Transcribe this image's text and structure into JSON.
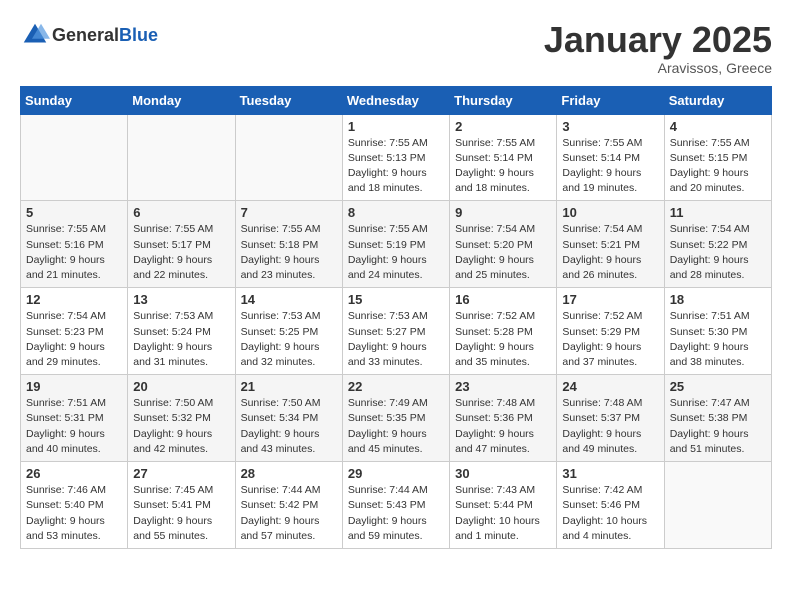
{
  "header": {
    "logo_general": "General",
    "logo_blue": "Blue",
    "month": "January 2025",
    "location": "Aravissos, Greece"
  },
  "weekdays": [
    "Sunday",
    "Monday",
    "Tuesday",
    "Wednesday",
    "Thursday",
    "Friday",
    "Saturday"
  ],
  "weeks": [
    [
      {
        "day": "",
        "info": ""
      },
      {
        "day": "",
        "info": ""
      },
      {
        "day": "",
        "info": ""
      },
      {
        "day": "1",
        "info": "Sunrise: 7:55 AM\nSunset: 5:13 PM\nDaylight: 9 hours and 18 minutes."
      },
      {
        "day": "2",
        "info": "Sunrise: 7:55 AM\nSunset: 5:14 PM\nDaylight: 9 hours and 18 minutes."
      },
      {
        "day": "3",
        "info": "Sunrise: 7:55 AM\nSunset: 5:14 PM\nDaylight: 9 hours and 19 minutes."
      },
      {
        "day": "4",
        "info": "Sunrise: 7:55 AM\nSunset: 5:15 PM\nDaylight: 9 hours and 20 minutes."
      }
    ],
    [
      {
        "day": "5",
        "info": "Sunrise: 7:55 AM\nSunset: 5:16 PM\nDaylight: 9 hours and 21 minutes."
      },
      {
        "day": "6",
        "info": "Sunrise: 7:55 AM\nSunset: 5:17 PM\nDaylight: 9 hours and 22 minutes."
      },
      {
        "day": "7",
        "info": "Sunrise: 7:55 AM\nSunset: 5:18 PM\nDaylight: 9 hours and 23 minutes."
      },
      {
        "day": "8",
        "info": "Sunrise: 7:55 AM\nSunset: 5:19 PM\nDaylight: 9 hours and 24 minutes."
      },
      {
        "day": "9",
        "info": "Sunrise: 7:54 AM\nSunset: 5:20 PM\nDaylight: 9 hours and 25 minutes."
      },
      {
        "day": "10",
        "info": "Sunrise: 7:54 AM\nSunset: 5:21 PM\nDaylight: 9 hours and 26 minutes."
      },
      {
        "day": "11",
        "info": "Sunrise: 7:54 AM\nSunset: 5:22 PM\nDaylight: 9 hours and 28 minutes."
      }
    ],
    [
      {
        "day": "12",
        "info": "Sunrise: 7:54 AM\nSunset: 5:23 PM\nDaylight: 9 hours and 29 minutes."
      },
      {
        "day": "13",
        "info": "Sunrise: 7:53 AM\nSunset: 5:24 PM\nDaylight: 9 hours and 31 minutes."
      },
      {
        "day": "14",
        "info": "Sunrise: 7:53 AM\nSunset: 5:25 PM\nDaylight: 9 hours and 32 minutes."
      },
      {
        "day": "15",
        "info": "Sunrise: 7:53 AM\nSunset: 5:27 PM\nDaylight: 9 hours and 33 minutes."
      },
      {
        "day": "16",
        "info": "Sunrise: 7:52 AM\nSunset: 5:28 PM\nDaylight: 9 hours and 35 minutes."
      },
      {
        "day": "17",
        "info": "Sunrise: 7:52 AM\nSunset: 5:29 PM\nDaylight: 9 hours and 37 minutes."
      },
      {
        "day": "18",
        "info": "Sunrise: 7:51 AM\nSunset: 5:30 PM\nDaylight: 9 hours and 38 minutes."
      }
    ],
    [
      {
        "day": "19",
        "info": "Sunrise: 7:51 AM\nSunset: 5:31 PM\nDaylight: 9 hours and 40 minutes."
      },
      {
        "day": "20",
        "info": "Sunrise: 7:50 AM\nSunset: 5:32 PM\nDaylight: 9 hours and 42 minutes."
      },
      {
        "day": "21",
        "info": "Sunrise: 7:50 AM\nSunset: 5:34 PM\nDaylight: 9 hours and 43 minutes."
      },
      {
        "day": "22",
        "info": "Sunrise: 7:49 AM\nSunset: 5:35 PM\nDaylight: 9 hours and 45 minutes."
      },
      {
        "day": "23",
        "info": "Sunrise: 7:48 AM\nSunset: 5:36 PM\nDaylight: 9 hours and 47 minutes."
      },
      {
        "day": "24",
        "info": "Sunrise: 7:48 AM\nSunset: 5:37 PM\nDaylight: 9 hours and 49 minutes."
      },
      {
        "day": "25",
        "info": "Sunrise: 7:47 AM\nSunset: 5:38 PM\nDaylight: 9 hours and 51 minutes."
      }
    ],
    [
      {
        "day": "26",
        "info": "Sunrise: 7:46 AM\nSunset: 5:40 PM\nDaylight: 9 hours and 53 minutes."
      },
      {
        "day": "27",
        "info": "Sunrise: 7:45 AM\nSunset: 5:41 PM\nDaylight: 9 hours and 55 minutes."
      },
      {
        "day": "28",
        "info": "Sunrise: 7:44 AM\nSunset: 5:42 PM\nDaylight: 9 hours and 57 minutes."
      },
      {
        "day": "29",
        "info": "Sunrise: 7:44 AM\nSunset: 5:43 PM\nDaylight: 9 hours and 59 minutes."
      },
      {
        "day": "30",
        "info": "Sunrise: 7:43 AM\nSunset: 5:44 PM\nDaylight: 10 hours and 1 minute."
      },
      {
        "day": "31",
        "info": "Sunrise: 7:42 AM\nSunset: 5:46 PM\nDaylight: 10 hours and 4 minutes."
      },
      {
        "day": "",
        "info": ""
      }
    ]
  ]
}
